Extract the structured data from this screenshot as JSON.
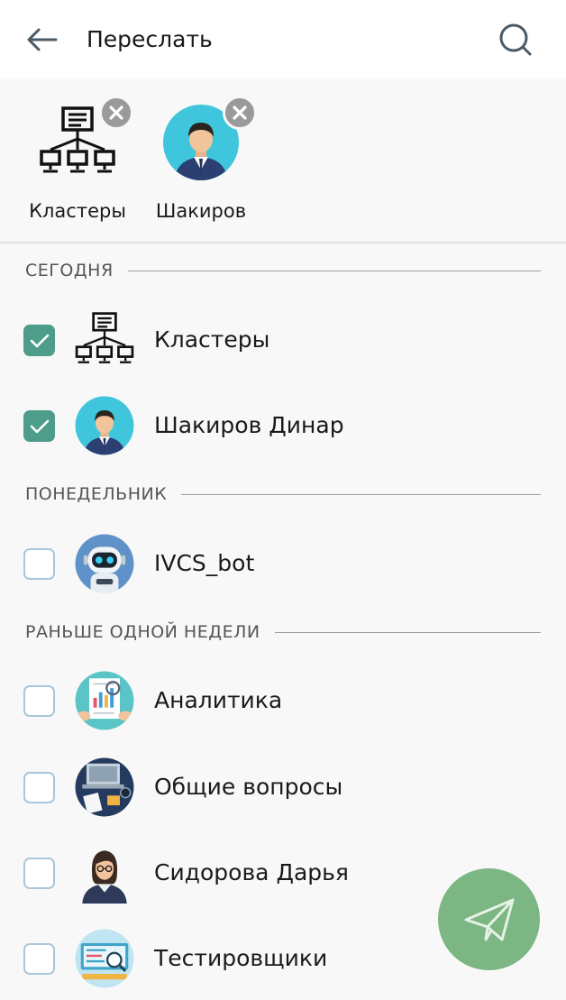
{
  "header": {
    "title": "Переслать",
    "back_icon": "arrow-left-icon",
    "search_icon": "search-icon"
  },
  "selected": [
    {
      "label": "Кластеры",
      "avatar": "network-cluster-icon"
    },
    {
      "label": "Шакиров",
      "avatar": "man-avatar"
    }
  ],
  "sections": [
    {
      "label": "СЕГОДНЯ",
      "items": [
        {
          "name": "Кластеры",
          "checked": true,
          "avatar": "network-cluster-icon"
        },
        {
          "name": "Шакиров Динар",
          "checked": true,
          "avatar": "man-avatar"
        }
      ]
    },
    {
      "label": "ПОНЕДЕЛЬНИК",
      "items": [
        {
          "name": "IVCS_bot",
          "checked": false,
          "avatar": "robot-avatar"
        }
      ]
    },
    {
      "label": "РАНЬШЕ ОДНОЙ НЕДЕЛИ",
      "items": [
        {
          "name": "Аналитика",
          "checked": false,
          "avatar": "analytics-avatar"
        },
        {
          "name": "Общие вопросы",
          "checked": false,
          "avatar": "workspace-avatar"
        },
        {
          "name": "Сидорова Дарья",
          "checked": false,
          "avatar": "woman-avatar"
        },
        {
          "name": "Тестировщики",
          "checked": false,
          "avatar": "testing-avatar"
        }
      ]
    }
  ],
  "fab": {
    "icon": "send-icon"
  },
  "colors": {
    "accent": "#4e9c8a",
    "fab": "#7cb682",
    "checkbox_border": "#a9c7d8",
    "avatar_cyan": "#3fc6dd"
  }
}
